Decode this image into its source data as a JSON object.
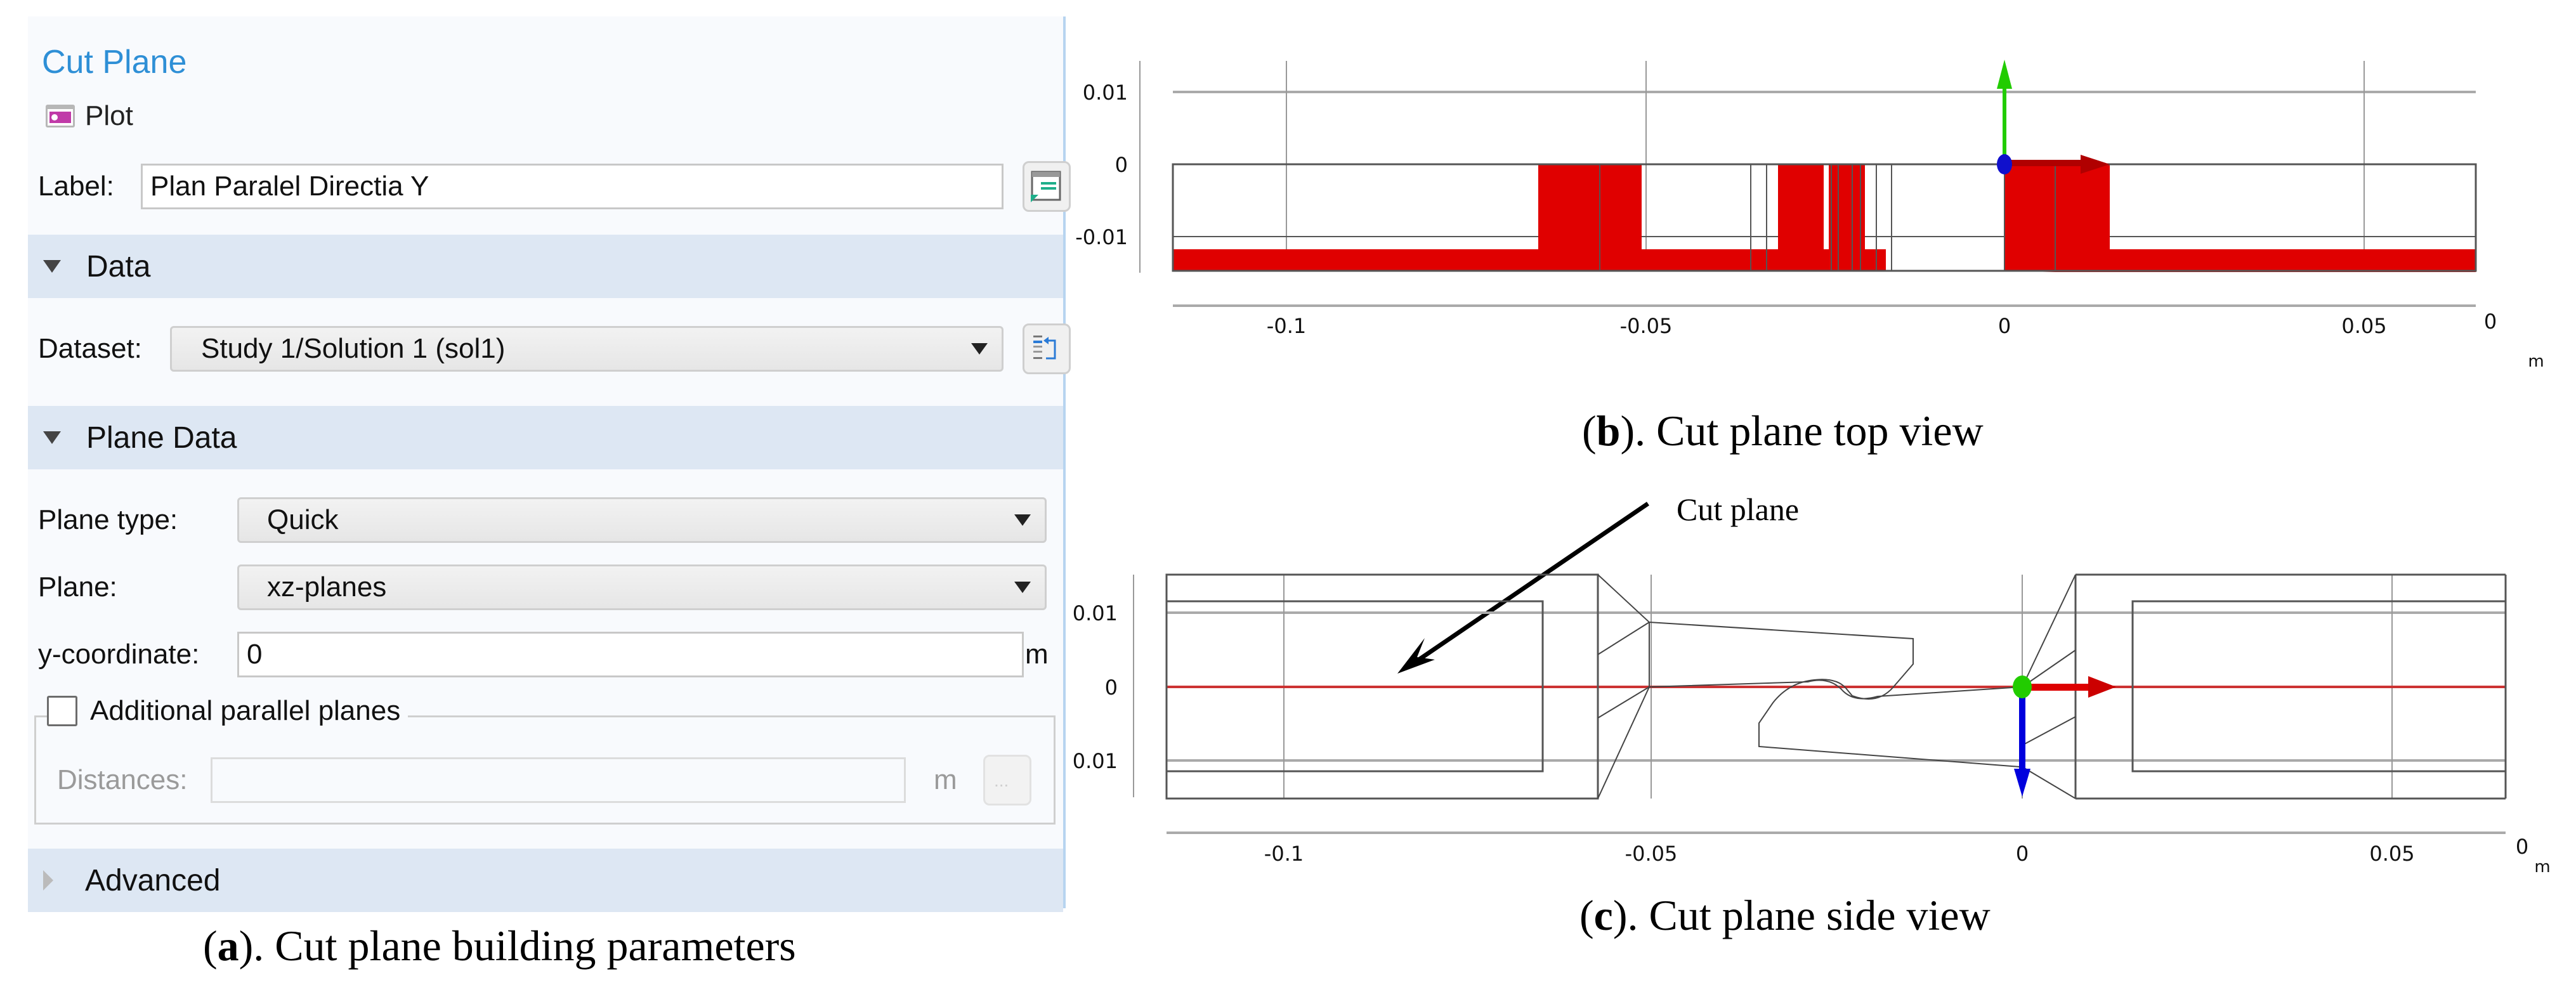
{
  "panel": {
    "title": "Cut Plane",
    "subtitle": "Plot",
    "label_field": {
      "label": "Label:",
      "value": "Plan Paralel Directia Y"
    },
    "sections": {
      "data": "Data",
      "plane_data": "Plane Data",
      "advanced": "Advanced"
    },
    "dataset": {
      "label": "Dataset:",
      "value": "Study 1/Solution 1 (sol1)"
    },
    "plane_type": {
      "label": "Plane type:",
      "value": "Quick"
    },
    "plane": {
      "label": "Plane:",
      "value": "xz-planes"
    },
    "y_coordinate": {
      "label": "y-coordinate:",
      "value": "0",
      "unit": "m"
    },
    "additional_planes": {
      "label": "Additional parallel planes",
      "checked": false
    },
    "distances": {
      "label": "Distances:",
      "value": "",
      "unit": "m",
      "button": "...",
      "enabled": false
    }
  },
  "captions": {
    "a": {
      "letter": "a",
      "text": "). Cut plane building parameters"
    },
    "b": {
      "letter": "b",
      "text": "). Cut plane top view"
    },
    "c": {
      "letter": "c",
      "text": "). Cut plane side view"
    }
  },
  "top_view": {
    "y_ticks": [
      "0.01",
      "0",
      "-0.01"
    ],
    "x_ticks": [
      "-0.1",
      "-0.05",
      "0",
      "0.05"
    ],
    "x_end_label": "0",
    "unit": "m",
    "highlight_color": "#e00000",
    "axis_colors": {
      "x": "#cc0000",
      "y": "#22cc00",
      "origin": "#1010cc"
    }
  },
  "side_view": {
    "annotation": "Cut plane",
    "y_ticks": [
      "0.01",
      "0",
      "0.01"
    ],
    "x_ticks": [
      "-0.1",
      "-0.05",
      "0",
      "0.05"
    ],
    "x_end_label": "0",
    "unit": "m",
    "cut_line_color": "#cc3333",
    "axis_colors": {
      "x": "#dd0000",
      "z": "#0000dd",
      "origin": "#22cc00"
    }
  }
}
